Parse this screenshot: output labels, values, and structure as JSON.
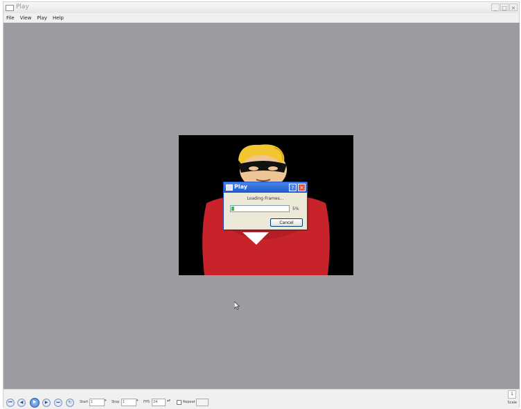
{
  "window": {
    "title": "Play",
    "controls": {
      "minimize": "_",
      "maximize": "□",
      "close": "×"
    }
  },
  "menu": {
    "items": [
      "File",
      "View",
      "Play",
      "Help"
    ]
  },
  "dialog": {
    "title": "Play",
    "help_label": "?",
    "close_label": "×",
    "message": "Loading Frames...",
    "progress_text": "5%",
    "progress_fraction": 0.05,
    "cancel_label": "Cancel"
  },
  "toolbar": {
    "buttons": [
      {
        "icon": "skip-to-start-icon"
      },
      {
        "icon": "step-back-icon"
      },
      {
        "icon": "play-icon",
        "active": true
      },
      {
        "icon": "step-forward-icon"
      },
      {
        "icon": "skip-to-end-icon"
      },
      {
        "icon": "loop-icon"
      }
    ],
    "start_label": "Start",
    "start_value": "1",
    "stop_label": "Stop",
    "stop_value": "1",
    "fps_label": "FPS",
    "fps_value": "24",
    "repeat_label": "Repeat",
    "repeat_checked": false,
    "zoom_value": "1",
    "scale_label": "Scale"
  },
  "colors": {
    "stage_background": "#9d9ba1",
    "movie_background": "#000000",
    "dialog_title_bar": "#1f58cf",
    "progress_fill": "#3cbc3c"
  }
}
